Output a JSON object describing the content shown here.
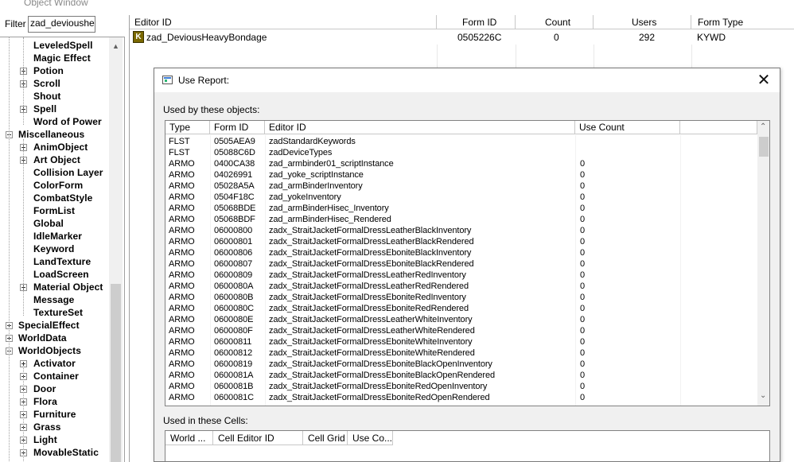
{
  "window": {
    "title": "Object Window"
  },
  "filter": {
    "label": "Filter",
    "value": "zad_deviousheavy"
  },
  "tree": {
    "items": [
      {
        "label": "LeveledSpell",
        "expander": "none"
      },
      {
        "label": "Magic Effect",
        "expander": "none"
      },
      {
        "label": "Potion",
        "expander": "plus"
      },
      {
        "label": "Scroll",
        "expander": "plus"
      },
      {
        "label": "Shout",
        "expander": "none"
      },
      {
        "label": "Spell",
        "expander": "plus"
      },
      {
        "label": "Word of Power",
        "expander": "none"
      },
      {
        "label": "Miscellaneous",
        "expander": "minus"
      },
      {
        "label": "AnimObject",
        "expander": "plus"
      },
      {
        "label": "Art Object",
        "expander": "plus"
      },
      {
        "label": "Collision Layer",
        "expander": "none"
      },
      {
        "label": "ColorForm",
        "expander": "none"
      },
      {
        "label": "CombatStyle",
        "expander": "none"
      },
      {
        "label": "FormList",
        "expander": "none"
      },
      {
        "label": "Global",
        "expander": "none"
      },
      {
        "label": "IdleMarker",
        "expander": "none"
      },
      {
        "label": "Keyword",
        "expander": "none"
      },
      {
        "label": "LandTexture",
        "expander": "none"
      },
      {
        "label": "LoadScreen",
        "expander": "none"
      },
      {
        "label": "Material Object",
        "expander": "plus"
      },
      {
        "label": "Message",
        "expander": "none"
      },
      {
        "label": "TextureSet",
        "expander": "none"
      },
      {
        "label": "SpecialEffect",
        "expander": "plus"
      },
      {
        "label": "WorldData",
        "expander": "plus"
      },
      {
        "label": "WorldObjects",
        "expander": "minus"
      },
      {
        "label": "Activator",
        "expander": "plus"
      },
      {
        "label": "Container",
        "expander": "plus"
      },
      {
        "label": "Door",
        "expander": "plus"
      },
      {
        "label": "Flora",
        "expander": "plus"
      },
      {
        "label": "Furniture",
        "expander": "plus"
      },
      {
        "label": "Grass",
        "expander": "plus"
      },
      {
        "label": "Light",
        "expander": "plus"
      },
      {
        "label": "MovableStatic",
        "expander": "plus"
      }
    ]
  },
  "main_list": {
    "columns": [
      "Editor ID",
      "Form ID",
      "Count",
      "Users",
      "Form Type"
    ],
    "rows": [
      {
        "icon": "K",
        "editor_id": "zad_DeviousHeavyBondage",
        "form_id": "0505226C",
        "count": "0",
        "users": "292",
        "form_type": "KYWD"
      }
    ]
  },
  "dialog": {
    "title": "Use Report:",
    "used_by_label": "Used by these objects:",
    "used_in_cells_label": "Used in these Cells:",
    "objects_columns": [
      "Type",
      "Form ID",
      "Editor ID",
      "Use Count"
    ],
    "objects": [
      [
        "FLST",
        "0505AEA9",
        "zadStandardKeywords",
        ""
      ],
      [
        "FLST",
        "05088C6D",
        "zadDeviceTypes",
        ""
      ],
      [
        "ARMO",
        "0400CA38",
        "zad_armbinder01_scriptInstance",
        "0"
      ],
      [
        "ARMO",
        "04026991",
        "zad_yoke_scriptInstance",
        "0"
      ],
      [
        "ARMO",
        "05028A5A",
        "zad_armBinderInventory",
        "0"
      ],
      [
        "ARMO",
        "0504F18C",
        "zad_yokeInventory",
        "0"
      ],
      [
        "ARMO",
        "05068BDE",
        "zad_armBinderHisec_Inventory",
        "0"
      ],
      [
        "ARMO",
        "05068BDF",
        "zad_armBinderHisec_Rendered",
        "0"
      ],
      [
        "ARMO",
        "06000800",
        "zadx_StraitJacketFormalDressLeatherBlackInventory",
        "0"
      ],
      [
        "ARMO",
        "06000801",
        "zadx_StraitJacketFormalDressLeatherBlackRendered",
        "0"
      ],
      [
        "ARMO",
        "06000806",
        "zadx_StraitJacketFormalDressEboniteBlackInventory",
        "0"
      ],
      [
        "ARMO",
        "06000807",
        "zadx_StraitJacketFormalDressEboniteBlackRendered",
        "0"
      ],
      [
        "ARMO",
        "06000809",
        "zadx_StraitJacketFormalDressLeatherRedInventory",
        "0"
      ],
      [
        "ARMO",
        "0600080A",
        "zadx_StraitJacketFormalDressLeatherRedRendered",
        "0"
      ],
      [
        "ARMO",
        "0600080B",
        "zadx_StraitJacketFormalDressEboniteRedInventory",
        "0"
      ],
      [
        "ARMO",
        "0600080C",
        "zadx_StraitJacketFormalDressEboniteRedRendered",
        "0"
      ],
      [
        "ARMO",
        "0600080E",
        "zadx_StraitJacketFormalDressLeatherWhiteInventory",
        "0"
      ],
      [
        "ARMO",
        "0600080F",
        "zadx_StraitJacketFormalDressLeatherWhiteRendered",
        "0"
      ],
      [
        "ARMO",
        "06000811",
        "zadx_StraitJacketFormalDressEboniteWhiteInventory",
        "0"
      ],
      [
        "ARMO",
        "06000812",
        "zadx_StraitJacketFormalDressEboniteWhiteRendered",
        "0"
      ],
      [
        "ARMO",
        "06000819",
        "zadx_StraitJacketFormalDressEboniteBlackOpenInventory",
        "0"
      ],
      [
        "ARMO",
        "0600081A",
        "zadx_StraitJacketFormalDressEboniteBlackOpenRendered",
        "0"
      ],
      [
        "ARMO",
        "0600081B",
        "zadx_StraitJacketFormalDressEboniteRedOpenInventory",
        "0"
      ],
      [
        "ARMO",
        "0600081C",
        "zadx_StraitJacketFormalDressEboniteRedOpenRendered",
        "0"
      ]
    ],
    "cells_columns": [
      "World ...",
      "Cell Editor ID",
      "Cell Grid",
      "Use Co..."
    ]
  }
}
